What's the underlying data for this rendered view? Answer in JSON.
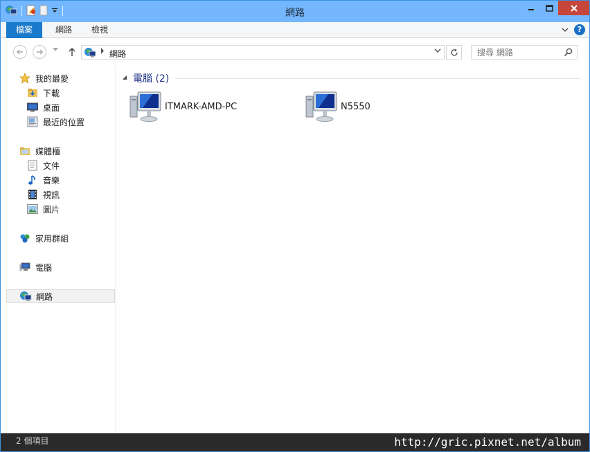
{
  "window": {
    "title": "網路"
  },
  "ribbon": {
    "tabs": [
      {
        "label": "檔案"
      },
      {
        "label": "網路"
      },
      {
        "label": "檢視"
      }
    ],
    "help_label": "?"
  },
  "address": {
    "path": "網路",
    "search_placeholder": "搜尋 網路"
  },
  "navpane": {
    "favorites": {
      "label": "我的最愛",
      "items": [
        {
          "label": "下載"
        },
        {
          "label": "桌面"
        },
        {
          "label": "最近的位置"
        }
      ]
    },
    "libraries": {
      "label": "媒體櫃",
      "items": [
        {
          "label": "文件"
        },
        {
          "label": "音樂"
        },
        {
          "label": "視訊"
        },
        {
          "label": "圖片"
        }
      ]
    },
    "homegroup": {
      "label": "家用群組"
    },
    "computer": {
      "label": "電腦"
    },
    "network": {
      "label": "網路"
    }
  },
  "content": {
    "group": {
      "label": "電腦 (2)"
    },
    "computers": [
      {
        "name": "ITMARK-AMD-PC"
      },
      {
        "name": "N5550"
      }
    ]
  },
  "status": {
    "item_count": "2 個項目"
  },
  "watermark": {
    "text": "http://gric.pixnet.net/album"
  }
}
